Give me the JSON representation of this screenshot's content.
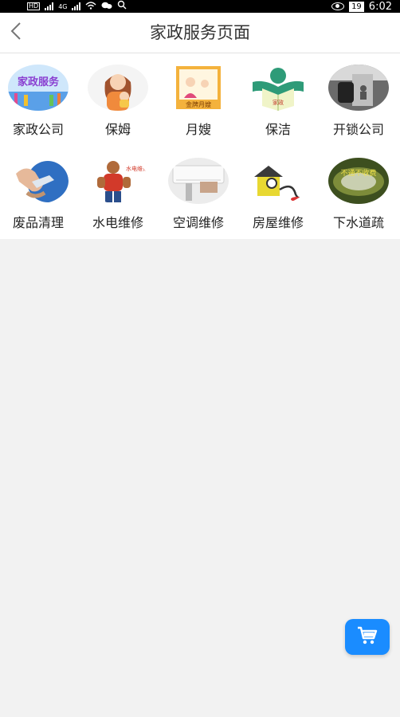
{
  "status_bar": {
    "network_badge": "HD",
    "signal_badge": "4G",
    "battery": "19",
    "time": "6:02"
  },
  "nav": {
    "title": "家政服务页面",
    "back_icon": "chevron-left-icon"
  },
  "services": [
    {
      "label": "家政公司",
      "image_text": "家政服务",
      "icon": "housekeeping-company-image"
    },
    {
      "label": "保姆",
      "image_text": "",
      "icon": "nanny-image"
    },
    {
      "label": "月嫂",
      "image_text": "金牌月嫂",
      "icon": "maternity-nurse-image"
    },
    {
      "label": "保洁",
      "image_text": "家政",
      "icon": "cleaning-image"
    },
    {
      "label": "开锁公司",
      "image_text": "",
      "icon": "locksmith-image"
    },
    {
      "label": "废品清理",
      "image_text": "",
      "icon": "waste-clearance-image"
    },
    {
      "label": "水电维修",
      "image_text": "水电维修",
      "icon": "plumbing-electric-repair-image"
    },
    {
      "label": "空调维修",
      "image_text": "",
      "icon": "air-conditioner-repair-image"
    },
    {
      "label": "房屋维修",
      "image_text": "",
      "icon": "house-repair-image"
    },
    {
      "label": "下水道疏",
      "image_text": "不通不收费",
      "icon": "drain-cleaning-image"
    }
  ],
  "fab": {
    "icon": "shopping-cart-icon"
  },
  "colors": {
    "accent": "#1a8cff",
    "page_bg": "#f2f2f2"
  }
}
